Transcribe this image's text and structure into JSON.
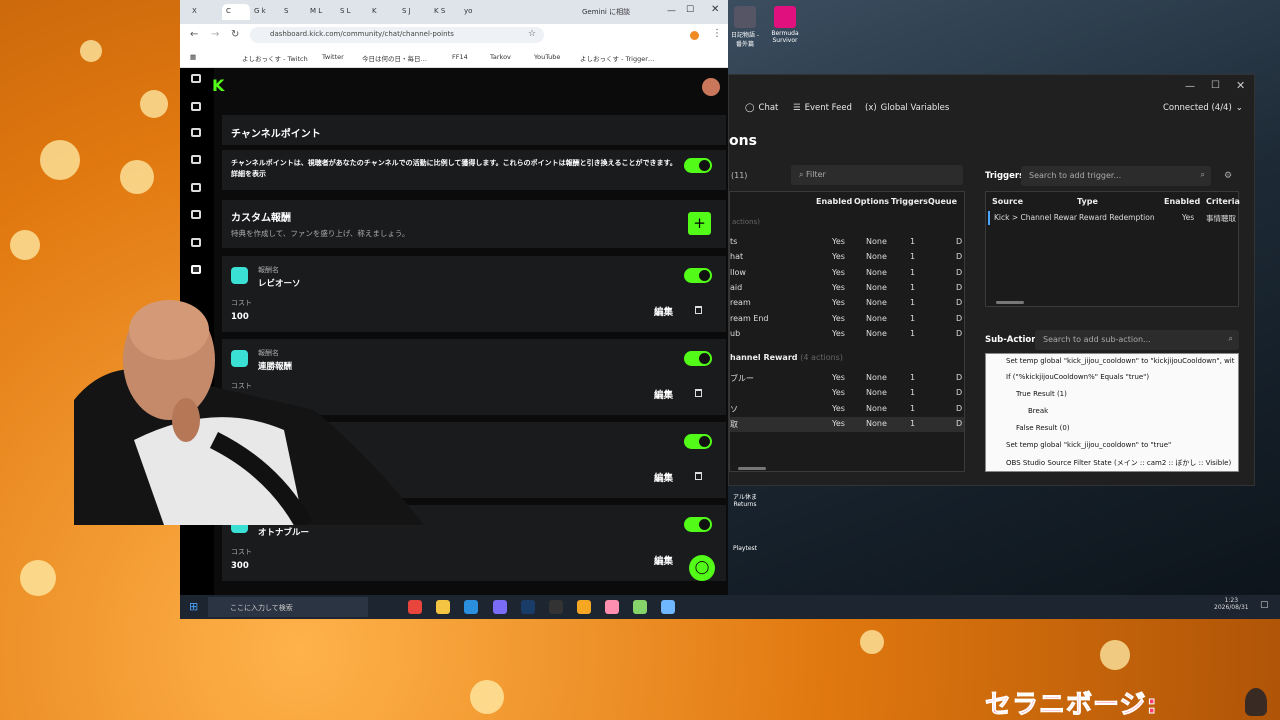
{
  "browser": {
    "tabs": [
      "X",
      "C",
      "G k",
      "S",
      "M L",
      "S L",
      "K",
      "S J",
      "K S",
      "yo",
      "Gemini に相談"
    ],
    "url": "dashboard.kick.com/community/chat/channel-points",
    "bookmarks": [
      "よしおっくす - Twitch",
      "Twitter",
      "今日は何の日・毎日…",
      "FF14",
      "Tarkov",
      "YouTube",
      "よしおっくす - Trigger…"
    ]
  },
  "kick": {
    "logo": "K",
    "section_title": "チャンネルポイント",
    "description": "チャンネルポイントは、視聴者があなたのチャンネルでの活動に比例して獲得します。これらのポイントは報酬と引き換えることができます。詳細を表示",
    "custom_title": "カスタム報酬",
    "custom_sub": "特典を作成して、ファンを盛り上げ、称えましょう。",
    "name_label": "報酬名",
    "cost_label": "コスト",
    "edit_label": "編集",
    "rewards": [
      {
        "name": "レビオーソ",
        "cost": "100"
      },
      {
        "name": "連勝報酬",
        "cost": ""
      },
      {
        "name": "",
        "cost": ""
      },
      {
        "name": "オトナブルー",
        "cost": "300"
      }
    ]
  },
  "streamerbot": {
    "nav": [
      "Chat",
      "Event Feed",
      "Global Variables"
    ],
    "connection": "Connected (4/4)",
    "page_title": "ons",
    "count": "(11)",
    "filter_placeholder": "Filter",
    "action_headers": [
      "Enabled",
      "Options",
      "Triggers",
      "Queue"
    ],
    "action_group_1": "actions)",
    "action_rows": [
      {
        "name": "ts",
        "enabled": "Yes",
        "options": "None",
        "triggers": "1",
        "queue": "D"
      },
      {
        "name": "hat",
        "enabled": "Yes",
        "options": "None",
        "triggers": "1",
        "queue": "D"
      },
      {
        "name": "llow",
        "enabled": "Yes",
        "options": "None",
        "triggers": "1",
        "queue": "D"
      },
      {
        "name": "aid",
        "enabled": "Yes",
        "options": "None",
        "triggers": "1",
        "queue": "D"
      },
      {
        "name": "ream",
        "enabled": "Yes",
        "options": "None",
        "triggers": "1",
        "queue": "D"
      },
      {
        "name": "ream End",
        "enabled": "Yes",
        "options": "None",
        "triggers": "1",
        "queue": "D"
      },
      {
        "name": "ub",
        "enabled": "Yes",
        "options": "None",
        "triggers": "1",
        "queue": "D"
      }
    ],
    "action_group_2": "hannel Reward",
    "action_group_2_count": "(4 actions)",
    "reward_rows": [
      {
        "name": "ブルー",
        "enabled": "Yes",
        "options": "None",
        "triggers": "1",
        "queue": "D"
      },
      {
        "name": "",
        "enabled": "Yes",
        "options": "None",
        "triggers": "1",
        "queue": "D"
      },
      {
        "name": "ソ",
        "enabled": "Yes",
        "options": "None",
        "triggers": "1",
        "queue": "D"
      },
      {
        "name": "取",
        "enabled": "Yes",
        "options": "None",
        "triggers": "1",
        "queue": "D"
      }
    ],
    "triggers_title": "Triggers",
    "trigger_search": "Search to add trigger...",
    "trigger_headers": [
      "Source",
      "Type",
      "Enabled",
      "Criteria"
    ],
    "trigger_row": {
      "source": "Kick > Channel Rewar",
      "type": "Reward Redemption",
      "enabled": "Yes",
      "criteria": "事情聴取"
    },
    "subactions_title": "Sub-Actions",
    "subaction_search": "Search to add sub-action...",
    "subactions": [
      "Set temp global \"kick_jijou_cooldown\" to \"kickjijouCooldown\", wit",
      "If (\"%kickjijouCooldown%\" Equals \"true\")",
      "True Result (1)",
      "Break",
      "False Result (0)",
      "Set temp global \"kick_jijou_cooldown\" to \"true\"",
      "OBS Studio Source Filter State (メイン :: cam2 :: ぼかし :: Visible)"
    ]
  },
  "desktop": {
    "icons": [
      "日記物語 -番外篇",
      "Bermuda Survivor",
      "アル休ま Returns",
      "Playtest"
    ]
  },
  "taskbar": {
    "search_placeholder": "ここに入力して検索",
    "time": "1:23",
    "date": "2026/08/31"
  },
  "overlay": {
    "brand": "セラニボージ:"
  }
}
